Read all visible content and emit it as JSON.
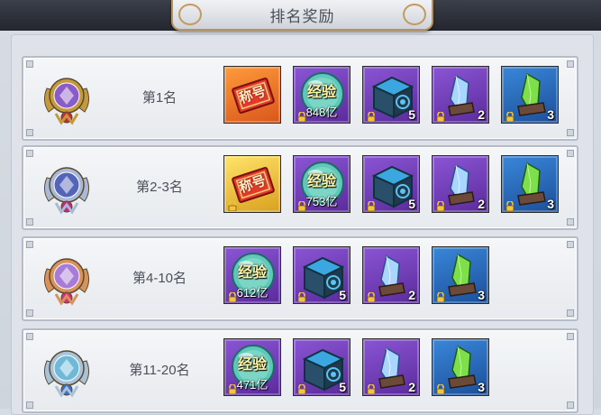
{
  "header": {
    "title": "排名奖励"
  },
  "colors": {
    "orange": "#e06a22",
    "gold": "#e7b93a",
    "purple": "#6c3bb6",
    "blue": "#2a69b8"
  },
  "rows": [
    {
      "rank": "第1名",
      "medal": "medal-purple-gold-icon",
      "items": [
        {
          "type": "title-token",
          "color": "orange",
          "label": "称号"
        },
        {
          "type": "exp-orb",
          "color": "purple",
          "label": "经验",
          "amount": "848亿"
        },
        {
          "type": "chest",
          "color": "purple",
          "count": "5"
        },
        {
          "type": "crystal-blue",
          "color": "purple",
          "count": "2"
        },
        {
          "type": "crystal-green",
          "color": "blue",
          "count": "3"
        }
      ]
    },
    {
      "rank": "第2-3名",
      "medal": "medal-diamond-silver-icon",
      "items": [
        {
          "type": "title-token",
          "color": "gold",
          "label": "称号"
        },
        {
          "type": "exp-orb",
          "color": "purple",
          "label": "经验",
          "amount": "753亿"
        },
        {
          "type": "chest",
          "color": "purple",
          "count": "5"
        },
        {
          "type": "crystal-blue",
          "color": "purple",
          "count": "2"
        },
        {
          "type": "crystal-green",
          "color": "blue",
          "count": "3"
        }
      ]
    },
    {
      "rank": "第4-10名",
      "medal": "medal-wings-bronze-icon",
      "items": [
        {
          "type": "exp-orb",
          "color": "purple",
          "label": "经验",
          "amount": "612亿"
        },
        {
          "type": "chest",
          "color": "purple",
          "count": "5"
        },
        {
          "type": "crystal-blue",
          "color": "purple",
          "count": "2"
        },
        {
          "type": "crystal-green",
          "color": "blue",
          "count": "3"
        }
      ]
    },
    {
      "rank": "第11-20名",
      "medal": "medal-swords-silver-icon",
      "items": [
        {
          "type": "exp-orb",
          "color": "purple",
          "label": "经验",
          "amount": "471亿"
        },
        {
          "type": "chest",
          "color": "purple",
          "count": "5"
        },
        {
          "type": "crystal-blue",
          "color": "purple",
          "count": "2"
        },
        {
          "type": "crystal-green",
          "color": "blue",
          "count": "3"
        }
      ]
    }
  ]
}
